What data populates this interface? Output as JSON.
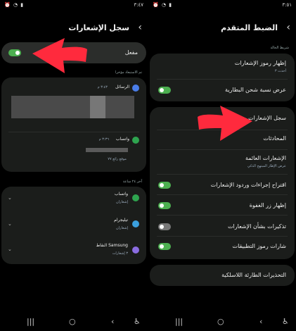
{
  "left": {
    "status": {
      "time": "٣:٤٧",
      "icons": "⏰ ◔ ▮"
    },
    "header": {
      "title": "سجل الإشعارات",
      "back": "‹"
    },
    "master": {
      "label": "مفعل",
      "on": true
    },
    "recent_label": "تم الاستبعاد مؤخرا",
    "recent_items": [
      {
        "app": "الرسائل",
        "time": "٣:٤٣ م",
        "color": "#4a7de8"
      },
      {
        "app": "واتساب",
        "time": "٣:٣٦ م",
        "color": "#2ea44f",
        "snippet": "موقع رائع ٧٧"
      }
    ],
    "day_label": "آخر ٢٤ ساعة",
    "day_items": [
      {
        "app": "واتساب",
        "sub": "إشعاران",
        "color": "#2ea44f"
      },
      {
        "app": "تيليجرام",
        "sub": "إشعاران",
        "color": "#3ba0de"
      },
      {
        "app": "Samsung النقاط",
        "sub": "٣ إشعارات",
        "color": "#8a6ce0"
      }
    ]
  },
  "right": {
    "status": {
      "time": "٣:٥١",
      "icons": "⏰ ◔ ▮"
    },
    "header": {
      "title": "الضبط المتقدم",
      "back": "‹"
    },
    "status_label": "شريط الحالة",
    "status_items": [
      {
        "title": "إظهار رموز الإشعارات",
        "sub": "أحدث ٣"
      },
      {
        "title": "عرض نسبة شحن البطارية",
        "toggle": true
      }
    ],
    "menu_items": [
      {
        "title": "سجل الإشعارات"
      },
      {
        "title": "المحادثات"
      },
      {
        "title": "الإشعارات العائمة",
        "sub": "عرض الإطار المبتهج الذكي"
      },
      {
        "title": "اقتراح إجراءات وردود الإشعارات",
        "toggle": true
      },
      {
        "title": "إظهار زر الغفوة",
        "toggle": true
      },
      {
        "title": "تذكيرات بشأن الإشعارات",
        "toggle": false
      },
      {
        "title": "شارات رموز التطبيقات",
        "toggle": true
      }
    ],
    "wireless": "التحذيرات الطارئة اللاسلكية"
  },
  "nav": {
    "recent": "|||",
    "home": "○",
    "back": "‹",
    "accessibility": "♿"
  },
  "colors": {
    "accent": "#4caf50",
    "arrow": "#ff2a3d"
  }
}
